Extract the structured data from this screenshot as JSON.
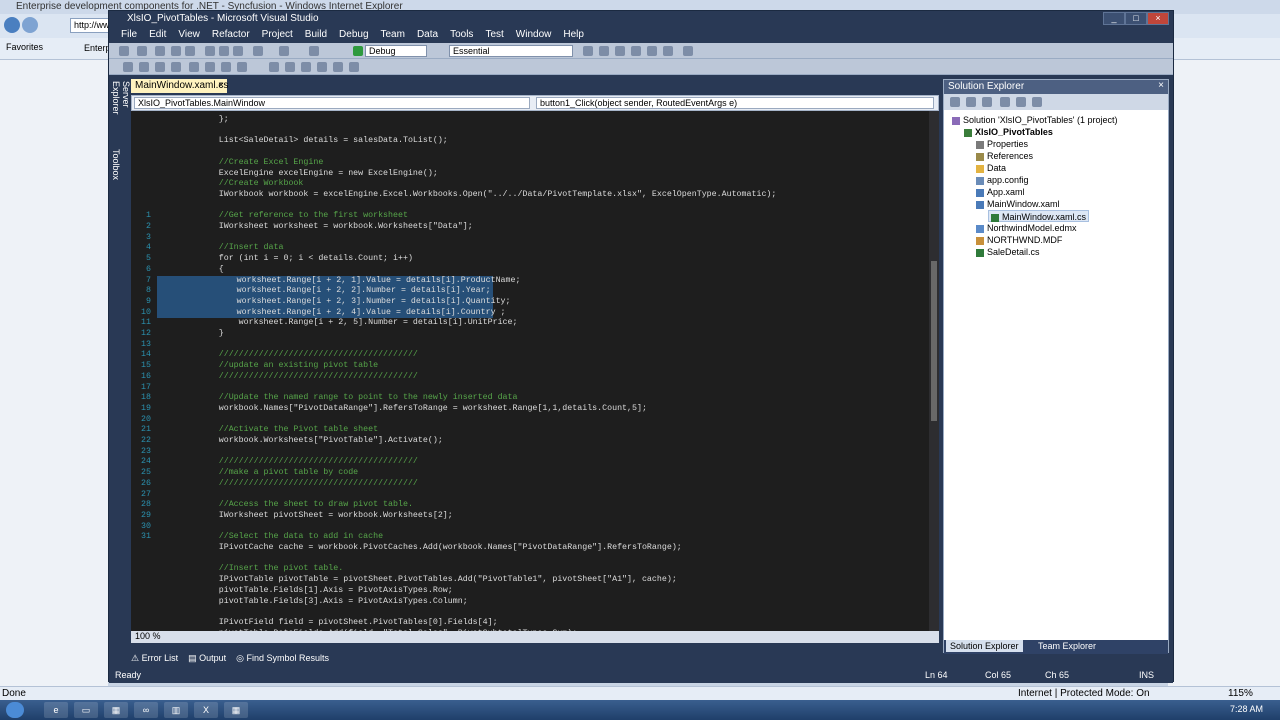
{
  "browser": {
    "title": "Enterprise development components for .NET - Syncfusion - Windows Internet Explorer",
    "address": "http://ww",
    "favorites": "Favorites",
    "tab": "Enterpr",
    "status_left": "Done",
    "status_mode": "Internet | Protected Mode: On",
    "zoom": "115%"
  },
  "taskbar": {
    "time": "7:28 AM"
  },
  "vs": {
    "title": "XlsIO_PivotTables - Microsoft Visual Studio",
    "menu": [
      "File",
      "Edit",
      "View",
      "Refactor",
      "Project",
      "Build",
      "Debug",
      "Team",
      "Data",
      "Tools",
      "Test",
      "Window",
      "Help"
    ],
    "config": "Debug",
    "platform": "Essential",
    "side_tabs": [
      "Server Explorer",
      "Toolbox"
    ],
    "doc_tab": "MainWindow.xaml.cs",
    "nav_left": "XlsIO_PivotTables.MainWindow",
    "nav_right": "button1_Click(object sender, RoutedEventArgs e)",
    "zoom": "100 %",
    "bottom_tabs": [
      "Error List",
      "Output",
      "Find Symbol Results"
    ],
    "status": {
      "ready": "Ready",
      "ln": "Ln 64",
      "col": "Col 65",
      "ch": "Ch 65",
      "ins": "INS"
    }
  },
  "code_lines": [
    {
      "n": "",
      "t": "            };",
      "c": ""
    },
    {
      "n": "",
      "t": "",
      "c": ""
    },
    {
      "n": "",
      "t": "            List<SaleDetail> details = salesData.ToList();",
      "c": ""
    },
    {
      "n": "",
      "t": "",
      "c": ""
    },
    {
      "n": "",
      "t": "            //Create Excel Engine",
      "c": "cm"
    },
    {
      "n": "",
      "t": "            ExcelEngine excelEngine = new ExcelEngine();",
      "c": ""
    },
    {
      "n": "",
      "t": "            //Create Workbook",
      "c": "cm"
    },
    {
      "n": "",
      "t": "            IWorkbook workbook = excelEngine.Excel.Workbooks.Open(\"../../Data/PivotTemplate.xlsx\", ExcelOpenType.Automatic);",
      "c": ""
    },
    {
      "n": "",
      "t": "",
      "c": ""
    },
    {
      "n": "1",
      "t": "            //Get reference to the first worksheet",
      "c": "cm"
    },
    {
      "n": "2",
      "t": "            IWorksheet worksheet = workbook.Worksheets[\"Data\"];",
      "c": ""
    },
    {
      "n": "3",
      "t": "",
      "c": ""
    },
    {
      "n": "4",
      "t": "            //Insert data",
      "c": "cm"
    },
    {
      "n": "5",
      "t": "            for (int i = 0; i < details.Count; i++)",
      "c": ""
    },
    {
      "n": "6",
      "t": "            {",
      "c": ""
    },
    {
      "n": "7",
      "t": "                worksheet.Range[i + 2, 1].Value = details[i].ProductName;",
      "c": "hl"
    },
    {
      "n": "8",
      "t": "                worksheet.Range[i + 2, 2].Number = details[i].Year;",
      "c": "hl"
    },
    {
      "n": "9",
      "t": "                worksheet.Range[i + 2, 3].Number = details[i].Quantity;",
      "c": "hl"
    },
    {
      "n": "10",
      "t": "                worksheet.Range[i + 2, 4].Value = details[i].Country ;",
      "c": "hl"
    },
    {
      "n": "11",
      "t": "                worksheet.Range[i + 2, 5].Number = details[i].UnitPrice;",
      "c": ""
    },
    {
      "n": "12",
      "t": "            }",
      "c": ""
    },
    {
      "n": "13",
      "t": "",
      "c": ""
    },
    {
      "n": "14",
      "t": "            ////////////////////////////////////////",
      "c": "cm"
    },
    {
      "n": "15",
      "t": "            //update an existing pivot table",
      "c": "cm"
    },
    {
      "n": "16",
      "t": "            ////////////////////////////////////////",
      "c": "cm"
    },
    {
      "n": "17",
      "t": "",
      "c": ""
    },
    {
      "n": "18",
      "t": "            //Update the named range to point to the newly inserted data",
      "c": "cm"
    },
    {
      "n": "19",
      "t": "            workbook.Names[\"PivotDataRange\"].RefersToRange = worksheet.Range[1,1,details.Count,5];",
      "c": ""
    },
    {
      "n": "20",
      "t": "",
      "c": ""
    },
    {
      "n": "21",
      "t": "            //Activate the Pivot table sheet",
      "c": "cm"
    },
    {
      "n": "22",
      "t": "            workbook.Worksheets[\"PivotTable\"].Activate();",
      "c": ""
    },
    {
      "n": "23",
      "t": "",
      "c": ""
    },
    {
      "n": "24",
      "t": "            ////////////////////////////////////////",
      "c": "cm"
    },
    {
      "n": "25",
      "t": "            //make a pivot table by code",
      "c": "cm"
    },
    {
      "n": "26",
      "t": "            ////////////////////////////////////////",
      "c": "cm"
    },
    {
      "n": "27",
      "t": "",
      "c": ""
    },
    {
      "n": "28",
      "t": "            //Access the sheet to draw pivot table.",
      "c": "cm"
    },
    {
      "n": "29",
      "t": "            IWorksheet pivotSheet = workbook.Worksheets[2];",
      "c": ""
    },
    {
      "n": "30",
      "t": "",
      "c": ""
    },
    {
      "n": "31",
      "t": "            //Select the data to add in cache",
      "c": "cm"
    },
    {
      "n": "",
      "t": "            IPivotCache cache = workbook.PivotCaches.Add(workbook.Names[\"PivotDataRange\"].RefersToRange);",
      "c": ""
    },
    {
      "n": "",
      "t": "",
      "c": ""
    },
    {
      "n": "",
      "t": "            //Insert the pivot table.",
      "c": "cm"
    },
    {
      "n": "",
      "t": "            IPivotTable pivotTable = pivotSheet.PivotTables.Add(\"PivotTable1\", pivotSheet[\"A1\"], cache);",
      "c": ""
    },
    {
      "n": "",
      "t": "            pivotTable.Fields[1].Axis = PivotAxisTypes.Row;",
      "c": ""
    },
    {
      "n": "",
      "t": "            pivotTable.Fields[3].Axis = PivotAxisTypes.Column;",
      "c": ""
    },
    {
      "n": "",
      "t": "",
      "c": ""
    },
    {
      "n": "",
      "t": "            IPivotField field = pivotSheet.PivotTables[0].Fields[4];",
      "c": ""
    },
    {
      "n": "",
      "t": "            pivotTable.DataFields.Add(field, \"Total Sales\", PivotSubtotalTypes.Sum);",
      "c": ""
    }
  ],
  "solution_explorer": {
    "title": "Solution Explorer",
    "items": [
      {
        "label": "Solution 'XlsIO_PivotTables' (1 project)",
        "indent": 0,
        "icon": "solution-icon"
      },
      {
        "label": "XlsIO_PivotTables",
        "indent": 1,
        "icon": "project-icon",
        "bold": true
      },
      {
        "label": "Properties",
        "indent": 2,
        "icon": "properties-icon"
      },
      {
        "label": "References",
        "indent": 2,
        "icon": "references-icon"
      },
      {
        "label": "Data",
        "indent": 2,
        "icon": "folder-icon"
      },
      {
        "label": "app.config",
        "indent": 2,
        "icon": "config-icon"
      },
      {
        "label": "App.xaml",
        "indent": 2,
        "icon": "xaml-icon"
      },
      {
        "label": "MainWindow.xaml",
        "indent": 2,
        "icon": "xaml-icon"
      },
      {
        "label": "MainWindow.xaml.cs",
        "indent": 3,
        "icon": "cs-icon",
        "selected": true
      },
      {
        "label": "NorthwindModel.edmx",
        "indent": 2,
        "icon": "edmx-icon"
      },
      {
        "label": "NORTHWND.MDF",
        "indent": 2,
        "icon": "db-icon"
      },
      {
        "label": "SaleDetail.cs",
        "indent": 2,
        "icon": "cs-icon"
      }
    ],
    "tabs": [
      "Solution Explorer",
      "Team Explorer"
    ]
  }
}
